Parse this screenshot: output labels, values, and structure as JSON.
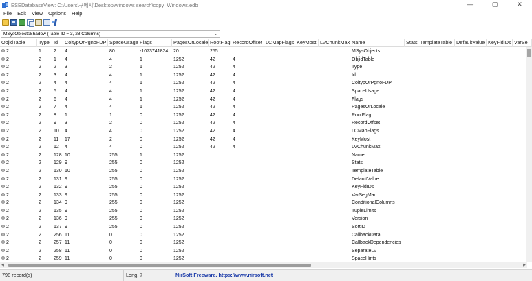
{
  "window": {
    "title": "ESEDatabaseView:  C:\\Users\\구에지\\Desktop\\windows search\\copy_Windows.edb",
    "minimize_glyph": "—",
    "maximize_glyph": "▢",
    "close_glyph": "✕"
  },
  "menu": [
    "File",
    "Edit",
    "View",
    "Options",
    "Help"
  ],
  "toolbar": [
    {
      "name": "open-icon",
      "cls": "tb-open"
    },
    {
      "name": "save-icon",
      "cls": "tb-save"
    },
    {
      "name": "refresh-icon",
      "cls": "tb-refresh"
    },
    {
      "name": "copy-icon",
      "cls": "tb-copy"
    },
    {
      "name": "properties-icon",
      "cls": "tb-props"
    },
    {
      "name": "html-report-icon",
      "cls": "tb-report"
    },
    {
      "name": "about-icon",
      "cls": "tb-about"
    }
  ],
  "table_select": {
    "value": "MSysObjectsShadow  (Table ID = 3, 28 Columns)",
    "chevron": "⌄"
  },
  "columns": [
    "ObjidTable",
    "Type",
    "Id",
    "ColtypOrPgnoFDP",
    "SpaceUsage",
    "Flags",
    "PagesOrLocale",
    "RootFlag",
    "RecordOffset",
    "LCMapFlags",
    "KeyMost",
    "LVChunkMax",
    "Name",
    "Stats",
    "TemplateTable",
    "DefaultValue",
    "KeyFldIDs",
    "VarSe"
  ],
  "sort_column_index": 0,
  "sort_glyph": "ˆ",
  "rows": [
    [
      "2",
      "1",
      "2",
      "4",
      "80",
      "-1073741824",
      "20",
      "255",
      "",
      "",
      "",
      "",
      "MSysObjects",
      "",
      "",
      "",
      "",
      ""
    ],
    [
      "2",
      "2",
      "1",
      "4",
      "4",
      "1",
      "1252",
      "42",
      "4",
      "",
      "",
      "",
      "ObjidTable",
      "",
      "",
      "",
      "",
      ""
    ],
    [
      "2",
      "2",
      "2",
      "3",
      "2",
      "1",
      "1252",
      "42",
      "4",
      "",
      "",
      "",
      "Type",
      "",
      "",
      "",
      "",
      ""
    ],
    [
      "2",
      "2",
      "3",
      "4",
      "4",
      "1",
      "1252",
      "42",
      "4",
      "",
      "",
      "",
      "Id",
      "",
      "",
      "",
      "",
      ""
    ],
    [
      "2",
      "2",
      "4",
      "4",
      "4",
      "1",
      "1252",
      "42",
      "4",
      "",
      "",
      "",
      "ColtypOrPgnoFDP",
      "",
      "",
      "",
      "",
      ""
    ],
    [
      "2",
      "2",
      "5",
      "4",
      "4",
      "1",
      "1252",
      "42",
      "4",
      "",
      "",
      "",
      "SpaceUsage",
      "",
      "",
      "",
      "",
      ""
    ],
    [
      "2",
      "2",
      "6",
      "4",
      "4",
      "1",
      "1252",
      "42",
      "4",
      "",
      "",
      "",
      "Flags",
      "",
      "",
      "",
      "",
      ""
    ],
    [
      "2",
      "2",
      "7",
      "4",
      "4",
      "1",
      "1252",
      "42",
      "4",
      "",
      "",
      "",
      "PagesOrLocale",
      "",
      "",
      "",
      "",
      ""
    ],
    [
      "2",
      "2",
      "8",
      "1",
      "1",
      "0",
      "1252",
      "42",
      "4",
      "",
      "",
      "",
      "RootFlag",
      "",
      "",
      "",
      "",
      ""
    ],
    [
      "2",
      "2",
      "9",
      "3",
      "2",
      "0",
      "1252",
      "42",
      "4",
      "",
      "",
      "",
      "RecordOffset",
      "",
      "",
      "",
      "",
      ""
    ],
    [
      "2",
      "2",
      "10",
      "4",
      "4",
      "0",
      "1252",
      "42",
      "4",
      "",
      "",
      "",
      "LCMapFlags",
      "",
      "",
      "",
      "",
      ""
    ],
    [
      "2",
      "2",
      "11",
      "17",
      "2",
      "0",
      "1252",
      "42",
      "4",
      "",
      "",
      "",
      "KeyMost",
      "",
      "",
      "",
      "",
      ""
    ],
    [
      "2",
      "2",
      "12",
      "4",
      "4",
      "0",
      "1252",
      "42",
      "4",
      "",
      "",
      "",
      "LVChunkMax",
      "",
      "",
      "",
      "",
      ""
    ],
    [
      "2",
      "2",
      "128",
      "10",
      "255",
      "1",
      "1252",
      "",
      "",
      "",
      "",
      "",
      "Name",
      "",
      "",
      "",
      "",
      ""
    ],
    [
      "2",
      "2",
      "129",
      "9",
      "255",
      "0",
      "1252",
      "",
      "",
      "",
      "",
      "",
      "Stats",
      "",
      "",
      "",
      "",
      ""
    ],
    [
      "2",
      "2",
      "130",
      "10",
      "255",
      "0",
      "1252",
      "",
      "",
      "",
      "",
      "",
      "TemplateTable",
      "",
      "",
      "",
      "",
      ""
    ],
    [
      "2",
      "2",
      "131",
      "9",
      "255",
      "0",
      "1252",
      "",
      "",
      "",
      "",
      "",
      "DefaultValue",
      "",
      "",
      "",
      "",
      ""
    ],
    [
      "2",
      "2",
      "132",
      "9",
      "255",
      "0",
      "1252",
      "",
      "",
      "",
      "",
      "",
      "KeyFldIDs",
      "",
      "",
      "",
      "",
      ""
    ],
    [
      "2",
      "2",
      "133",
      "9",
      "255",
      "0",
      "1252",
      "",
      "",
      "",
      "",
      "",
      "VarSegMac",
      "",
      "",
      "",
      "",
      ""
    ],
    [
      "2",
      "2",
      "134",
      "9",
      "255",
      "0",
      "1252",
      "",
      "",
      "",
      "",
      "",
      "ConditionalColumns",
      "",
      "",
      "",
      "",
      ""
    ],
    [
      "2",
      "2",
      "135",
      "9",
      "255",
      "0",
      "1252",
      "",
      "",
      "",
      "",
      "",
      "TupleLimits",
      "",
      "",
      "",
      "",
      ""
    ],
    [
      "2",
      "2",
      "136",
      "9",
      "255",
      "0",
      "1252",
      "",
      "",
      "",
      "",
      "",
      "Version",
      "",
      "",
      "",
      "",
      ""
    ],
    [
      "2",
      "2",
      "137",
      "9",
      "255",
      "0",
      "1252",
      "",
      "",
      "",
      "",
      "",
      "SortID",
      "",
      "",
      "",
      "",
      ""
    ],
    [
      "2",
      "2",
      "256",
      "11",
      "0",
      "0",
      "1252",
      "",
      "",
      "",
      "",
      "",
      "CallbackData",
      "",
      "",
      "",
      "",
      ""
    ],
    [
      "2",
      "2",
      "257",
      "11",
      "0",
      "0",
      "1252",
      "",
      "",
      "",
      "",
      "",
      "CallbackDependencies",
      "",
      "",
      "",
      "",
      ""
    ],
    [
      "2",
      "2",
      "258",
      "11",
      "0",
      "0",
      "1252",
      "",
      "",
      "",
      "",
      "",
      "SeparateLV",
      "",
      "",
      "",
      "",
      ""
    ],
    [
      "2",
      "2",
      "259",
      "11",
      "0",
      "0",
      "1252",
      "",
      "",
      "",
      "",
      "",
      "SpaceHints",
      "",
      "",
      "",
      "",
      ""
    ]
  ],
  "status": {
    "records": "798 record(s)",
    "column_type": "Long, 7",
    "link": "NirSoft Freeware. https://www.nirsoft.net"
  },
  "colors": {
    "link": "#1a3aa8",
    "statusbar_bg": "#f0f0f0"
  }
}
